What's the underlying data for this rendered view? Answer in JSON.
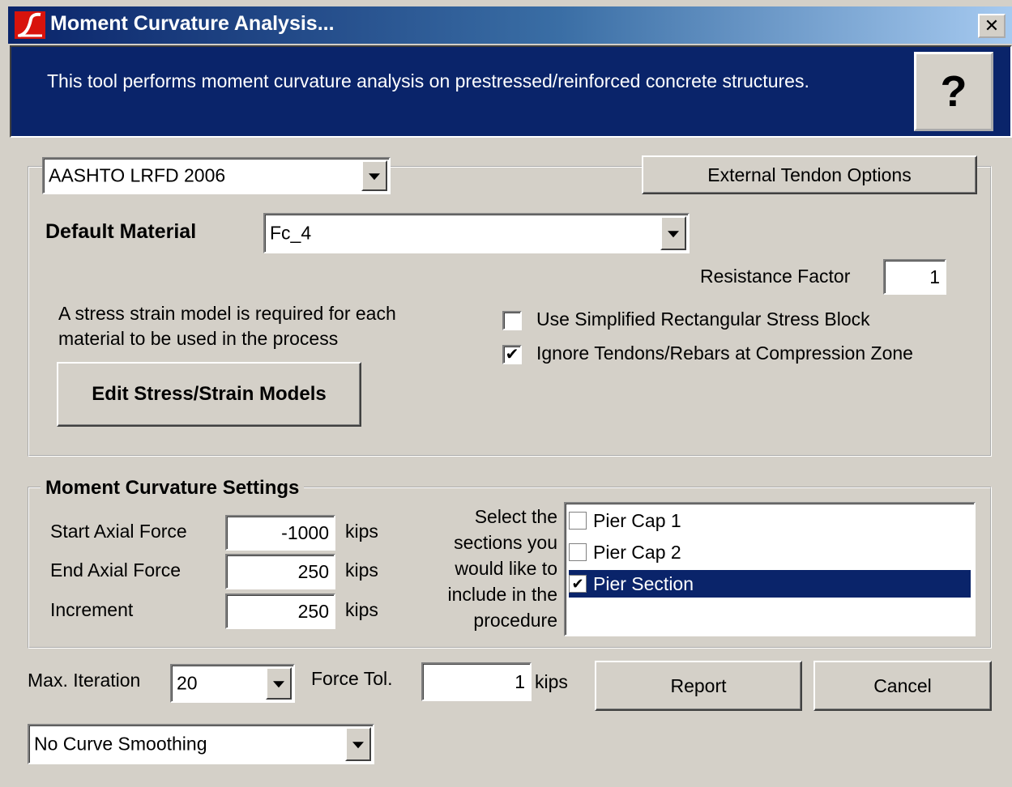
{
  "window": {
    "title": "Moment Curvature Analysis...",
    "close_glyph": "✕"
  },
  "banner": {
    "text": "This tool performs moment curvature analysis on prestressed/reinforced concrete structures.",
    "help_label": "?"
  },
  "design_code": {
    "value": "AASHTO LRFD 2006"
  },
  "external_tendon_button": "External Tendon Options",
  "default_material": {
    "label": "Default Material",
    "value": "Fc_4"
  },
  "resistance_factor": {
    "label": "Resistance Factor",
    "value": "1"
  },
  "stress_strain_note": "A stress strain model is required for each material to be used in the process",
  "edit_models_button": "Edit Stress/Strain Models",
  "options": {
    "simplified_block": {
      "label": "Use Simplified Rectangular Stress Block",
      "checked": false
    },
    "ignore_tendons": {
      "label": "Ignore Tendons/Rebars at Compression Zone",
      "checked": true
    }
  },
  "moment_settings": {
    "group_label": "Moment Curvature Settings",
    "start_axial": {
      "label": "Start Axial Force",
      "value": "-1000",
      "unit": "kips"
    },
    "end_axial": {
      "label": "End Axial Force",
      "value": "250",
      "unit": "kips"
    },
    "increment": {
      "label": "Increment",
      "value": "250",
      "unit": "kips"
    },
    "sections_prompt": "Select the sections you would like to include in the procedure",
    "sections": [
      {
        "label": "Pier Cap 1",
        "checked": false,
        "selected": false
      },
      {
        "label": "Pier Cap 2",
        "checked": false,
        "selected": false
      },
      {
        "label": "Pier Section",
        "checked": true,
        "selected": true
      }
    ]
  },
  "max_iteration": {
    "label": "Max. Iteration",
    "value": "20"
  },
  "force_tol": {
    "label": "Force Tol.",
    "value": "1",
    "unit": "kips"
  },
  "report_button": "Report",
  "cancel_button": "Cancel",
  "smoothing": {
    "value": "No Curve Smoothing"
  },
  "colors": {
    "titlebar": "#0a246a",
    "banner": "#0a246a",
    "face": "#d4d0c8",
    "accent_icon": "#d8130c"
  }
}
